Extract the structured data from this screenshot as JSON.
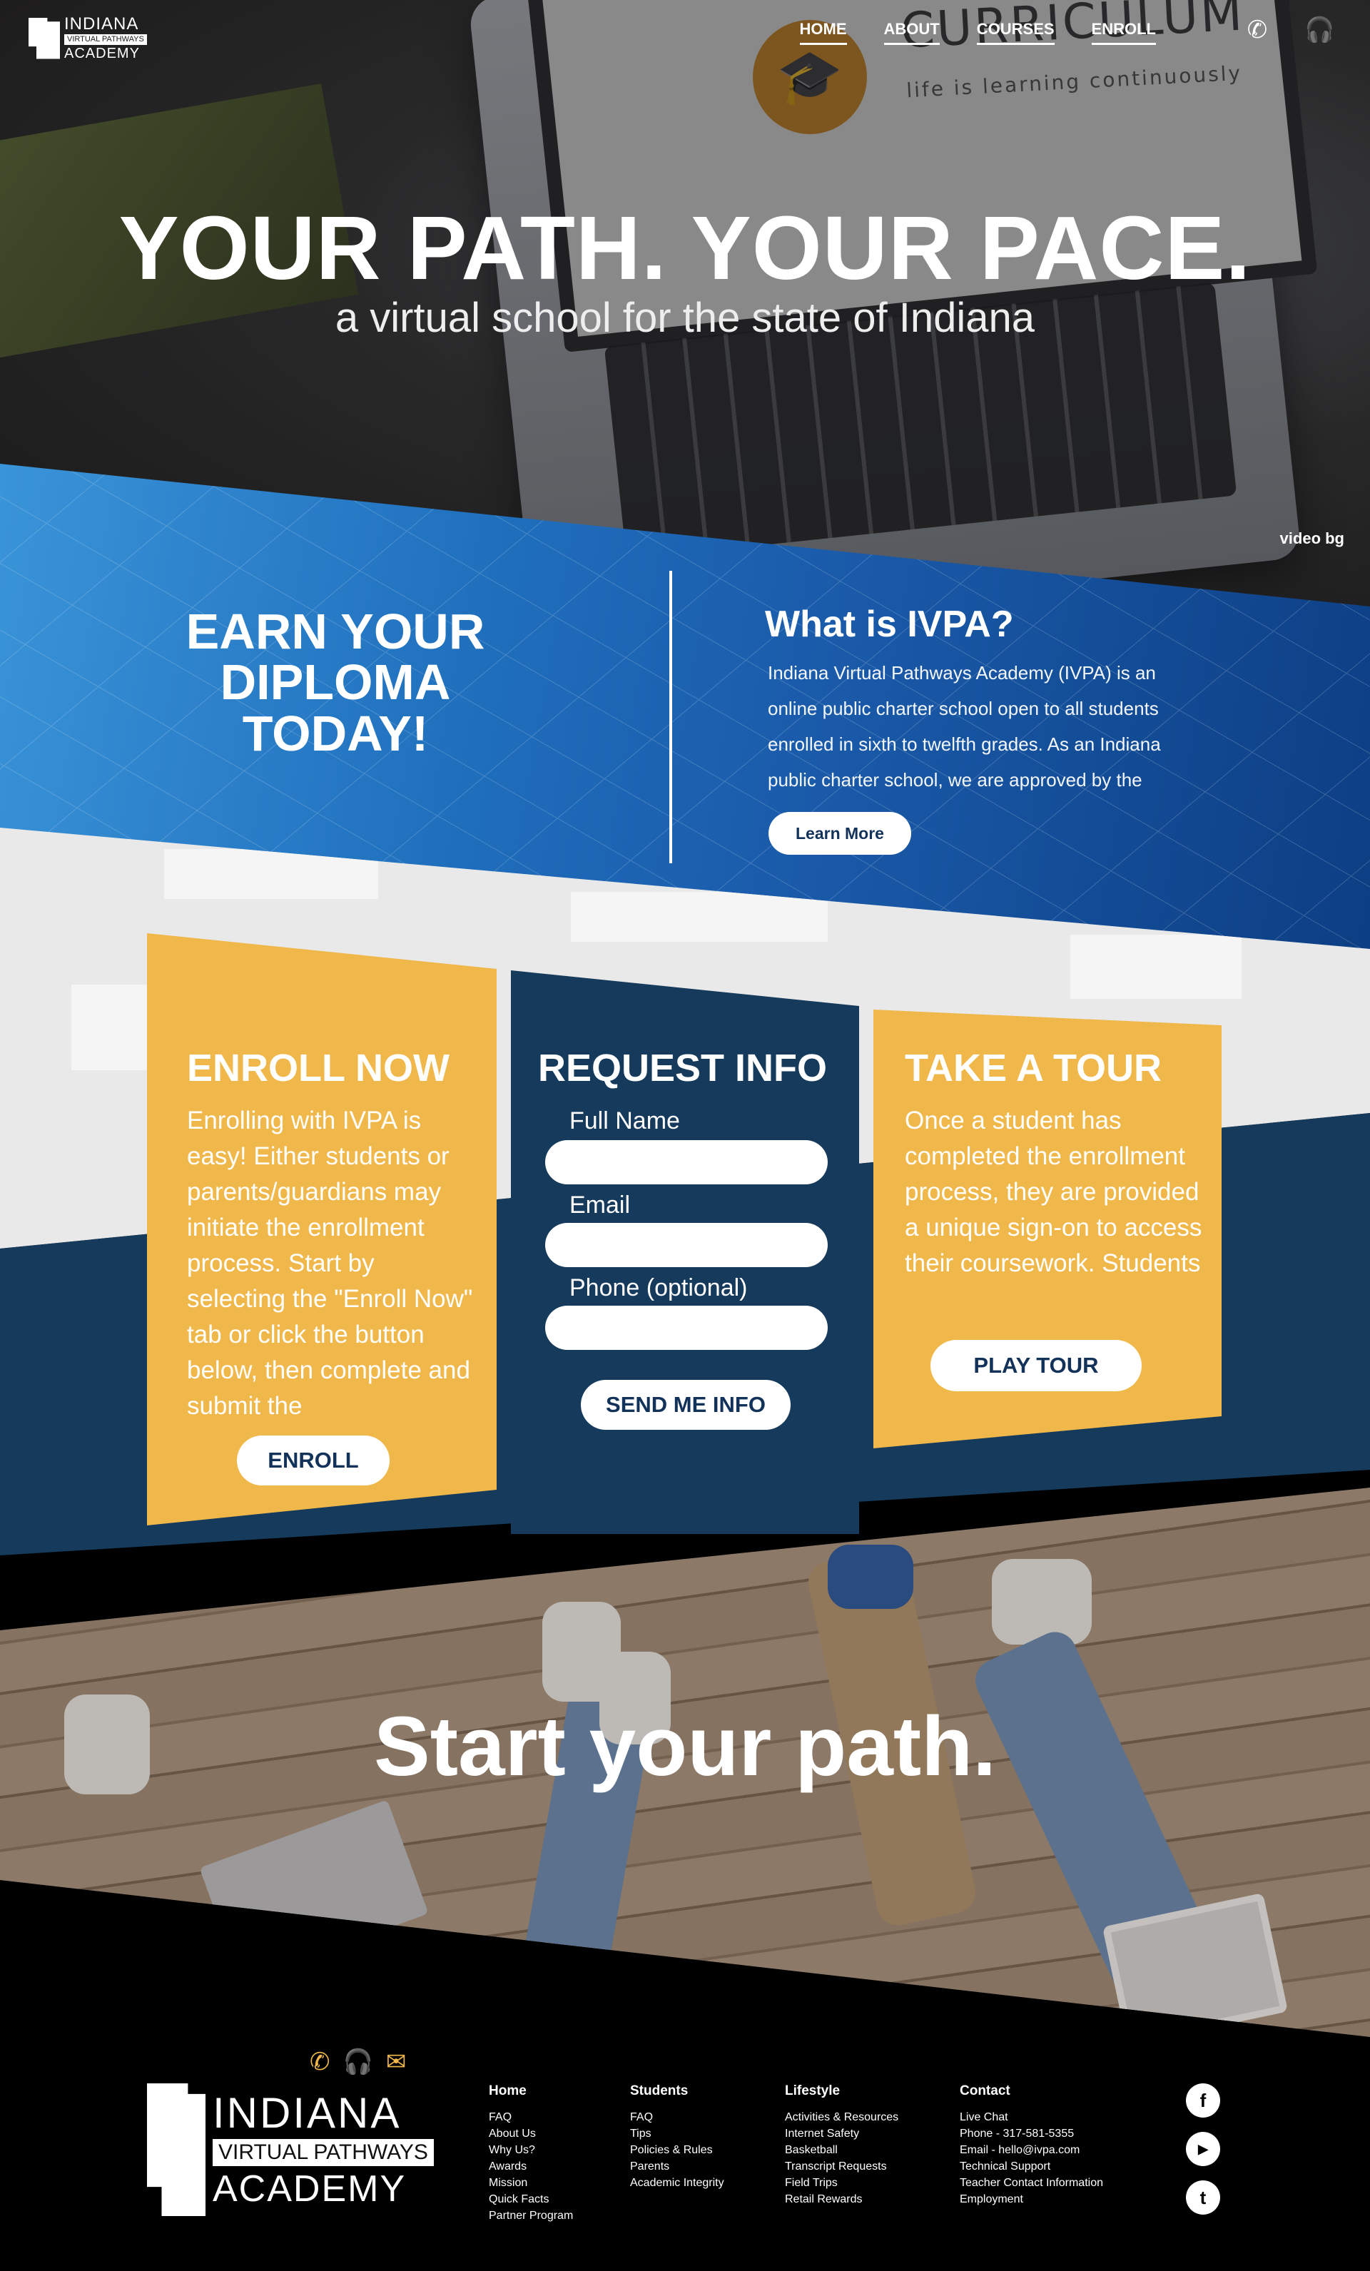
{
  "header": {
    "logo": {
      "line1": "INDIANA",
      "line2": "VIRTUAL PATHWAYS",
      "line3": "ACADEMY"
    },
    "nav": [
      "HOME",
      "ABOUT",
      "COURSES",
      "ENROLL"
    ],
    "icons": [
      "phone-icon",
      "headset-icon"
    ]
  },
  "hero": {
    "title": "YOUR PATH. YOUR PACE.",
    "subtitle": "a virtual school for the state of Indiana",
    "screen_word": "CURRICULUM",
    "screen_tagline": "life is learning continuously",
    "video_label": "video bg"
  },
  "intro": {
    "earn": "EARN YOUR DIPLOMA TODAY!",
    "what_title": "What is IVPA?",
    "what_body": "Indiana Virtual Pathways Academy (IVPA) is an online public charter school open to all students enrolled in sixth to twelfth grades. As an Indiana public charter school, we are approved by the",
    "learn_more": "Learn More"
  },
  "enroll_card": {
    "title": "ENROLL NOW",
    "body": "Enrolling with IVPA is easy! Either students or parents/guardians may initiate the enrollment process. Start by selecting the \"Enroll Now\" tab or click the button below, then complete and submit the",
    "button": "ENROLL"
  },
  "request_card": {
    "title": "REQUEST INFO",
    "name_label": "Full Name",
    "email_label": "Email",
    "phone_label": "Phone (optional)",
    "button": "SEND ME INFO"
  },
  "tour_card": {
    "title": "TAKE A TOUR",
    "body": "Once a student has completed the enrollment process, they are provided a unique sign-on to access their coursework. Students",
    "button": "PLAY TOUR"
  },
  "photo_section": {
    "title": "Start your path."
  },
  "footer": {
    "icons": [
      "phone-icon",
      "headset-icon",
      "mail-icon"
    ],
    "logo": {
      "line1": "INDIANA",
      "line2": "VIRTUAL PATHWAYS",
      "line3": "ACADEMY"
    },
    "columns": [
      {
        "title": "Home",
        "items": [
          "FAQ",
          "About Us",
          "Why Us?",
          "Awards",
          "Mission",
          "Quick Facts",
          "Partner Program"
        ]
      },
      {
        "title": "Students",
        "items": [
          "FAQ",
          "Tips",
          "Policies & Rules",
          "Parents",
          "Academic Integrity"
        ]
      },
      {
        "title": "Lifestyle",
        "items": [
          "Activities & Resources",
          "Internet Safety",
          "Basketball",
          "Transcript Requests",
          "Field Trips",
          "Retail Rewards"
        ]
      },
      {
        "title": "Contact",
        "items": [
          "Live Chat",
          "Phone - 317-581-5355",
          "Email - hello@ivpa.com",
          "Technical Support",
          "Teacher Contact Information",
          "Employment"
        ]
      }
    ],
    "social": [
      {
        "name": "facebook-icon",
        "glyph": "f"
      },
      {
        "name": "youtube-icon",
        "glyph": "▶"
      },
      {
        "name": "twitter-icon",
        "glyph": "t"
      }
    ]
  },
  "colors": {
    "blue": "#1f6fbd",
    "navy": "#163a5c",
    "yellow": "#f0b84a",
    "black": "#000000"
  }
}
